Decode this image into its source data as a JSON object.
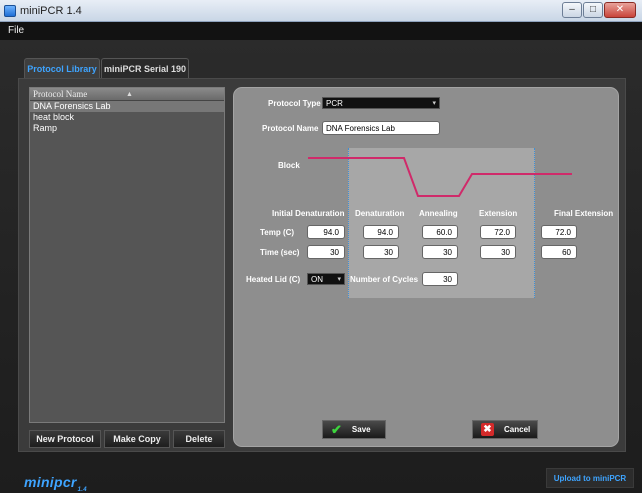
{
  "window": {
    "title": "miniPCR 1.4"
  },
  "menu": {
    "file": "File"
  },
  "tabs": [
    {
      "label": "Protocol Library",
      "active": true
    },
    {
      "label": "miniPCR Serial 190",
      "active": false
    }
  ],
  "library": {
    "header": "Protocol Name",
    "items": [
      "DNA Forensics Lab",
      "heat block",
      "Ramp"
    ],
    "selected_index": 0,
    "new_label": "New Protocol",
    "copy_label": "Make Copy",
    "delete_label": "Delete"
  },
  "editor": {
    "protocol_type_label": "Protocol Type",
    "protocol_type_value": "PCR",
    "protocol_name_label": "Protocol Name",
    "protocol_name_value": "DNA Forensics Lab",
    "block_label": "Block",
    "stage_headers": [
      "Initial Denaturation",
      "Denaturation",
      "Annealing",
      "Extension",
      "Final Extension"
    ],
    "temp_label": "Temp (C)",
    "time_label": "Time (sec)",
    "temps": [
      "94.0",
      "94.0",
      "60.0",
      "72.0",
      "72.0"
    ],
    "times": [
      "30",
      "30",
      "30",
      "30",
      "60"
    ],
    "heated_lid_label": "Heated Lid (C)",
    "heated_lid_value": "ON",
    "cycles_label": "Number of Cycles",
    "cycles_value": "30",
    "save_label": "Save",
    "cancel_label": "Cancel"
  },
  "footer": {
    "logo": "minipcr",
    "version": "1.4",
    "upload_label": "Upload to miniPCR"
  },
  "colors": {
    "accent": "#3ea4ff",
    "profile_line": "#d02a6a"
  }
}
